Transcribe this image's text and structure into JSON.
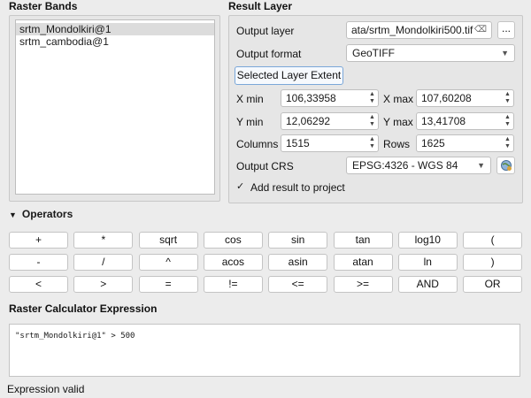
{
  "raster_bands": {
    "title": "Raster Bands",
    "items": [
      "srtm_Mondolkiri@1",
      "srtm_cambodia@1"
    ]
  },
  "result_layer": {
    "title": "Result Layer",
    "output_layer_label": "Output layer",
    "output_layer_value": "ata/srtm_Mondolkiri500.tif",
    "browse_label": "...",
    "output_format_label": "Output format",
    "output_format_value": "GeoTIFF",
    "extent_button": "Selected Layer Extent",
    "xmin_label": "X min",
    "xmin_value": "106,33958",
    "xmax_label": "X max",
    "xmax_value": "107,60208",
    "ymin_label": "Y min",
    "ymin_value": "12,06292",
    "ymax_label": "Y max",
    "ymax_value": "13,41708",
    "columns_label": "Columns",
    "columns_value": "1515",
    "rows_label": "Rows",
    "rows_value": "1625",
    "crs_label": "Output CRS",
    "crs_value": "EPSG:4326 - WGS 84",
    "add_result_label": "Add result to project"
  },
  "operators": {
    "title": "Operators",
    "row1": [
      "+",
      "*",
      "sqrt",
      "cos",
      "sin",
      "tan",
      "log10",
      "("
    ],
    "row2": [
      "-",
      "/",
      "^",
      "acos",
      "asin",
      "atan",
      "ln",
      ")"
    ],
    "row3": [
      "<",
      ">",
      "=",
      "!=",
      "<=",
      ">=",
      "AND",
      "OR"
    ]
  },
  "expression": {
    "title": "Raster Calculator Expression",
    "text": "\"srtm_Mondolkiri@1\" > 500"
  },
  "status": {
    "text": "Expression valid"
  }
}
